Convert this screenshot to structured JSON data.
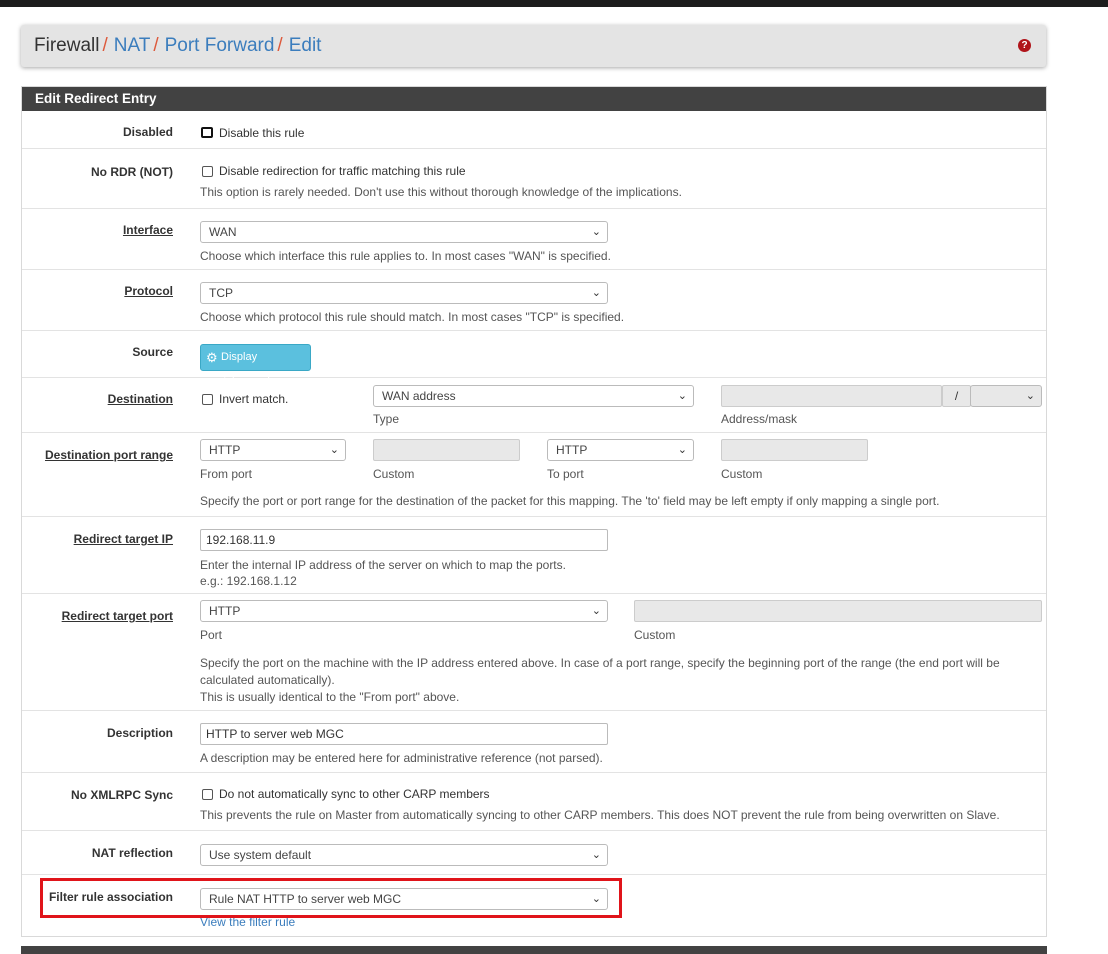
{
  "breadcrumb": {
    "item1": "Firewall",
    "item2": "NAT",
    "item3": "Port Forward",
    "item4": "Edit",
    "separator": "/",
    "help_icon": "question-circle-icon"
  },
  "panel": {
    "title": "Edit Redirect Entry"
  },
  "disabled": {
    "label": "Disabled",
    "checkbox_text": "Disable this rule",
    "checked": false
  },
  "nordr": {
    "label": "No RDR (NOT)",
    "checkbox_text": "Disable redirection for traffic matching this rule",
    "help": "This option is rarely needed. Don't use this without thorough knowledge of the implications."
  },
  "interface": {
    "label": "Interface",
    "value": "WAN",
    "help": "Choose which interface this rule applies to. In most cases \"WAN\" is specified."
  },
  "protocol": {
    "label": "Protocol",
    "value": "TCP",
    "help": "Choose which protocol this rule should match. In most cases \"TCP\" is specified."
  },
  "source": {
    "label": "Source",
    "button": "Display Advanced",
    "icon": "gear-icon"
  },
  "destination": {
    "label": "Destination",
    "invert_text": "Invert match.",
    "type_value": "WAN address",
    "type_caption": "Type",
    "address_value": "",
    "mask_sep": "/",
    "address_caption": "Address/mask"
  },
  "dest_port": {
    "label": "Destination port range",
    "from_value": "HTTP",
    "from_caption": "From port",
    "from_custom_caption": "Custom",
    "to_value": "HTTP",
    "to_caption": "To port",
    "to_custom_caption": "Custom",
    "help": "Specify the port or port range for the destination of the packet for this mapping. The 'to' field may be left empty if only mapping a single port."
  },
  "redirect_ip": {
    "label": "Redirect target IP",
    "value": "192.168.11.9",
    "help1": "Enter the internal IP address of the server on which to map the ports.",
    "help2": "e.g.: 192.168.1.12"
  },
  "redirect_port": {
    "label": "Redirect target port",
    "value": "HTTP",
    "caption": "Port",
    "custom_caption": "Custom",
    "help1": "Specify the port on the machine with the IP address entered above. In case of a port range, specify the beginning port of the range (the end port will be",
    "help2": "calculated automatically).",
    "help3": "This is usually identical to the \"From port\" above."
  },
  "description": {
    "label": "Description",
    "value": "HTTP to server web MGC",
    "help": "A description may be entered here for administrative reference (not parsed)."
  },
  "xmlrpc": {
    "label": "No XMLRPC Sync",
    "checkbox_text": "Do not automatically sync to other CARP members",
    "help": "This prevents the rule on Master from automatically syncing to other CARP members. This does NOT prevent the rule from being overwritten on Slave."
  },
  "nat_reflection": {
    "label": "NAT reflection",
    "value": "Use system default"
  },
  "filter_assoc": {
    "label": "Filter rule association",
    "value": "Rule NAT HTTP to server web MGC",
    "link": "View the filter rule"
  },
  "colors": {
    "accent": "#3b7dbd",
    "panel_header": "#424242",
    "highlight": "#e0141a",
    "info_button": "#5bc0de"
  }
}
